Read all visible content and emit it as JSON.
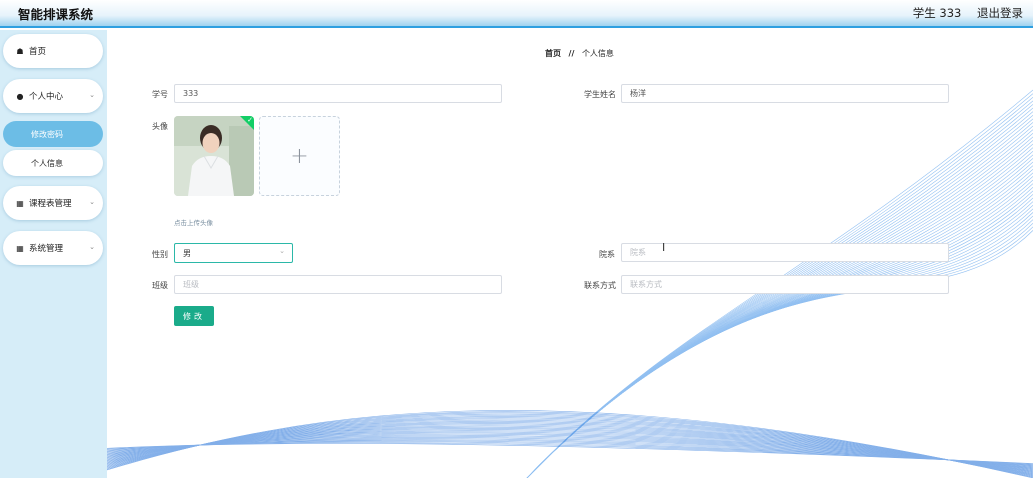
{
  "header": {
    "app_title": "智能排课系统",
    "user_label": "学生 333",
    "logout_label": "退出登录"
  },
  "sidebar": {
    "home": "首页",
    "personal_center": "个人中心",
    "change_password": "修改密码",
    "personal_info": "个人信息",
    "course_schedule": "课程表管理",
    "system_manage": "系统管理"
  },
  "breadcrumb": {
    "home": "首页",
    "separator": "//",
    "current": "个人信息"
  },
  "form": {
    "student_id_label": "学号",
    "student_id_value": "333",
    "student_name_label": "学生姓名",
    "student_name_value": "杨洋",
    "avatar_label": "头像",
    "upload_tip": "点击上传头像",
    "gender_label": "性别",
    "gender_value": "男",
    "department_label": "院系",
    "department_placeholder": "院系",
    "class_label": "班级",
    "class_placeholder": "班级",
    "contact_label": "联系方式",
    "contact_placeholder": "联系方式",
    "submit_label": "修改"
  },
  "colors": {
    "accent_blue": "#2e9fe0",
    "active_menu": "#6cbde6",
    "button_teal": "#1aab8a",
    "sidebar_bg": "#d6edf8"
  },
  "icons": {
    "home": "home-icon",
    "user": "user-icon",
    "grid": "grid-icon",
    "apps": "apps-icon",
    "chevron": "chevron-down-icon",
    "plus": "plus-icon",
    "check": "check-icon"
  }
}
